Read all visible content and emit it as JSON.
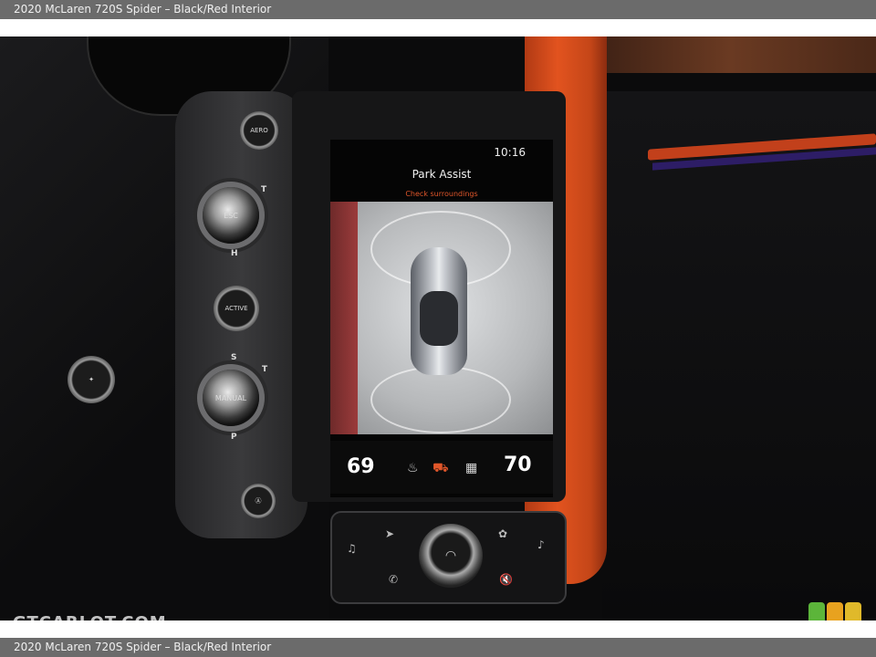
{
  "caption_top": "2020 McLaren 720S Spider – Black/Red Interior",
  "caption_bottom": "2020 McLaren 720S Spider – Black/Red Interior",
  "screen": {
    "clock": "10:16",
    "title": "Park Assist",
    "warning": "Check surroundings",
    "temp_left": "69",
    "temp_right": "70"
  },
  "buttons": {
    "aero": "AERO",
    "esc": "ESC",
    "active": "ACTIVE",
    "manual": "MANUAL",
    "dial_top_letters": [
      "T",
      "H"
    ],
    "dial_bottom_letters": [
      "S",
      "T",
      "P"
    ]
  },
  "watermark": "GTCARLOT.COM",
  "colors": {
    "accent_orange": "#e2531f",
    "warning": "#e0562a",
    "logo_green": "#5cb53a",
    "logo_orange": "#e8a21f",
    "logo_yellow": "#e0b92a"
  }
}
